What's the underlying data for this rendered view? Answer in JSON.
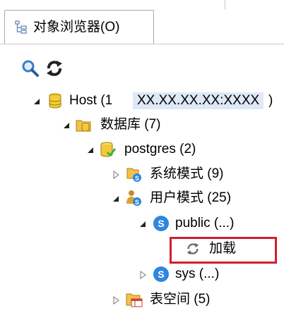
{
  "tab": {
    "label": "对象浏览器(O)",
    "icon": "object-browser-tree-icon"
  },
  "toolbar": {
    "search_icon": "magnifier-icon",
    "refresh_icon": "refresh-icon"
  },
  "tree": {
    "host": {
      "label_prefix": "Host (1",
      "address": "XX.XX.XX.XX:XXXX",
      "label_suffix": ")"
    },
    "databases": {
      "label": "数据库 (7)"
    },
    "postgres": {
      "label": "postgres (2)"
    },
    "system_schemas": {
      "label": "系统模式 (9)"
    },
    "user_schemas": {
      "label": "用户模式 (25)"
    },
    "public": {
      "label": "public (...)"
    },
    "loading": {
      "label": "加载"
    },
    "sys": {
      "label": "sys (...)"
    },
    "tablespaces": {
      "label": "表空间 (5)"
    }
  },
  "colors": {
    "highlight_box": "#d21e2e",
    "selection_bg": "#dfe8f6",
    "schema_blue": "#2e86de"
  }
}
